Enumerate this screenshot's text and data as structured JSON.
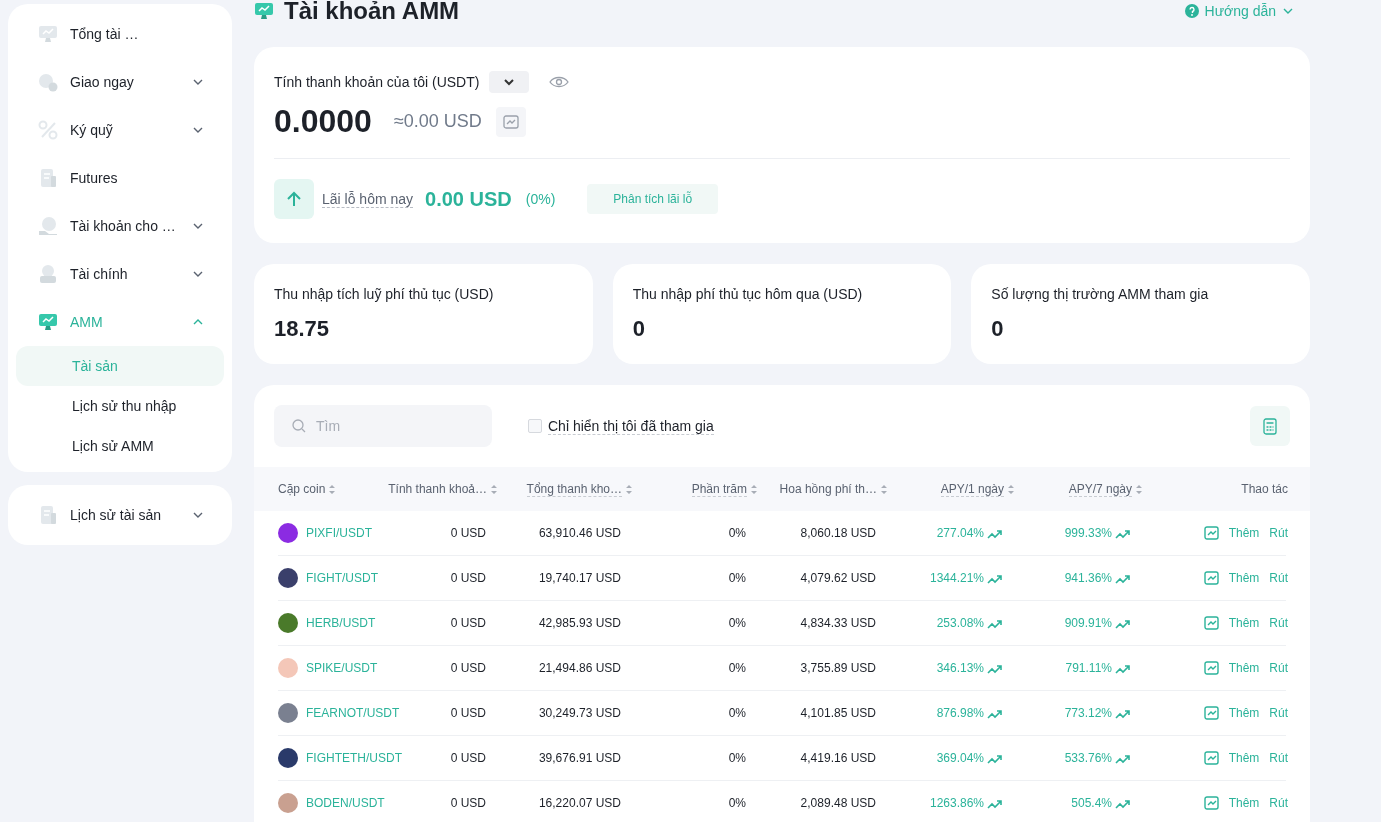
{
  "sidebar": {
    "groups": [
      {
        "items": [
          {
            "kind": "plain",
            "label": "Tổng tài …",
            "selected": false
          },
          {
            "kind": "menu",
            "label": "Giao ngay",
            "expanded": false,
            "selected": false
          },
          {
            "kind": "menu",
            "label": "Ký quỹ",
            "expanded": false,
            "selected": false
          },
          {
            "kind": "plain",
            "label": "Futures",
            "selected": false
          },
          {
            "kind": "menu",
            "label": "Tài khoản cho …",
            "expanded": false,
            "selected": false
          },
          {
            "kind": "menu",
            "label": "Tài chính",
            "expanded": false,
            "selected": false
          },
          {
            "kind": "menu",
            "label": "AMM",
            "expanded": true,
            "selected": true,
            "children": [
              {
                "label": "Tài sản",
                "selected": true
              },
              {
                "label": "Lịch sử thu nhập",
                "selected": false
              },
              {
                "label": "Lịch sử AMM",
                "selected": false
              }
            ]
          }
        ]
      },
      {
        "items": [
          {
            "kind": "menu",
            "label": "Lịch sử tài sản",
            "expanded": false,
            "selected": false
          }
        ]
      }
    ]
  },
  "page": {
    "title": "Tài khoản AMM",
    "help": "Hướng dẫn"
  },
  "liquidity": {
    "label": "Tính thanh khoản của tôi (USDT)",
    "amount": "0.0000",
    "approx": "≈0.00 USD",
    "pnl_label": "Lãi lỗ hôm nay",
    "pnl_value": "0.00 USD",
    "pnl_percent": "(0%)",
    "analyze_button": "Phân tích lãi lỗ"
  },
  "stats": [
    {
      "label": "Thu nhập tích luỹ phí thủ tục (USD)",
      "value": "18.75"
    },
    {
      "label": "Thu nhập phí thủ tục hôm qua (USD)",
      "value": "0"
    },
    {
      "label": "Số lượng thị trường AMM tham gia",
      "value": "0"
    }
  ],
  "filters": {
    "search_placeholder": "Tìm",
    "only_joined": {
      "label": "Chỉ hiển thị tôi đã tham gia",
      "checked": false
    }
  },
  "table": {
    "columns": [
      "Cặp coin",
      "Tính thanh khoả…",
      "Tổng thanh kho…",
      "Phần trăm",
      "Hoa hồng phí th…",
      "APY/1 ngày",
      "APY/7 ngày",
      "Thao tác"
    ],
    "rows": [
      {
        "pair": "PIXFI/USDT",
        "color": "#8b2be2",
        "mine": "0 USD",
        "total": "63,910.46 USD",
        "share": "0%",
        "fee": "8,060.18 USD",
        "apy1": "277.04%",
        "apy7": "999.33%",
        "actions": [
          "Thêm",
          "Rút"
        ]
      },
      {
        "pair": "FIGHT/USDT",
        "color": "#3a3f6b",
        "mine": "0 USD",
        "total": "19,740.17 USD",
        "share": "0%",
        "fee": "4,079.62 USD",
        "apy1": "1344.21%",
        "apy7": "941.36%",
        "actions": [
          "Thêm",
          "Rút"
        ]
      },
      {
        "pair": "HERB/USDT",
        "color": "#4a7a2a",
        "mine": "0 USD",
        "total": "42,985.93 USD",
        "share": "0%",
        "fee": "4,834.33 USD",
        "apy1": "253.08%",
        "apy7": "909.91%",
        "actions": [
          "Thêm",
          "Rút"
        ]
      },
      {
        "pair": "SPIKE/USDT",
        "color": "#f4c7b8",
        "mine": "0 USD",
        "total": "21,494.86 USD",
        "share": "0%",
        "fee": "3,755.89 USD",
        "apy1": "346.13%",
        "apy7": "791.11%",
        "actions": [
          "Thêm",
          "Rút"
        ]
      },
      {
        "pair": "FEARNOT/USDT",
        "color": "#7a8090",
        "mine": "0 USD",
        "total": "30,249.73 USD",
        "share": "0%",
        "fee": "4,101.85 USD",
        "apy1": "876.98%",
        "apy7": "773.12%",
        "actions": [
          "Thêm",
          "Rút"
        ]
      },
      {
        "pair": "FIGHTETH/USDT",
        "color": "#2a3a6a",
        "mine": "0 USD",
        "total": "39,676.91 USD",
        "share": "0%",
        "fee": "4,419.16 USD",
        "apy1": "369.04%",
        "apy7": "533.76%",
        "actions": [
          "Thêm",
          "Rút"
        ]
      },
      {
        "pair": "BODEN/USDT",
        "color": "#c9a090",
        "mine": "0 USD",
        "total": "16,220.07 USD",
        "share": "0%",
        "fee": "2,089.48 USD",
        "apy1": "1263.86%",
        "apy7": "505.4%",
        "actions": [
          "Thêm",
          "Rút"
        ]
      }
    ]
  }
}
